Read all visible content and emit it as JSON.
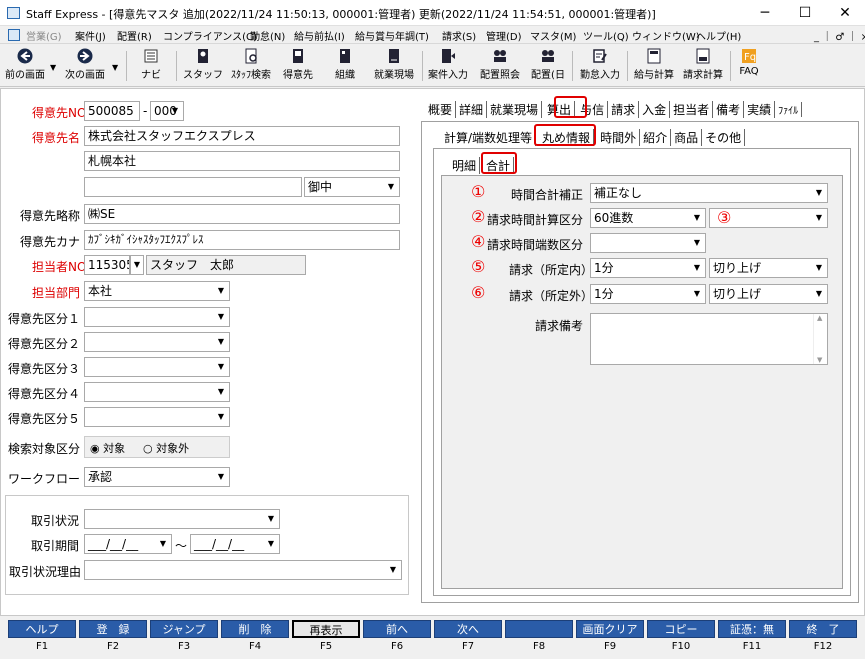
{
  "window": {
    "title": "Staff Express - [得意先マスタ 追加(2022/11/24 11:50:13, 000001:管理者) 更新(2022/11/24 11:54:51, 000001:管理者)]",
    "minimize": "─",
    "maximize": "☐",
    "close": "✕"
  },
  "menu": {
    "items": [
      "営業(G)",
      "案件(J)",
      "配置(R)",
      "コンプライアンス(C)",
      "勤怠(N)",
      "給与前払(I)",
      "給与賞与年調(T)",
      "請求(S)",
      "管理(D)",
      "マスタ(M)",
      "ツール(Q)",
      "ウィンドウ(W)",
      "ヘルプ(H)"
    ],
    "right": "_ ｜ ♂ ｜ ×"
  },
  "toolbar": {
    "items": [
      "前の画面",
      "次の画面",
      "ナビ",
      "スタッフ",
      "ｽﾀｯﾌ検索",
      "得意先",
      "組織",
      "就業現場",
      "案件入力",
      "配置照会",
      "配置(日",
      "勤怠入力",
      "給与計算",
      "請求計算",
      "FAQ"
    ]
  },
  "left": {
    "code_label": "得意先NO",
    "code_value": "500085",
    "code_sep": "-",
    "branch_value": "000",
    "name_label": "得意先名",
    "name_value": "株式会社スタッフエクスプレス",
    "name2_value": "札幌本社",
    "name3_value": "",
    "honorific": "御中",
    "short_label": "得意先略称",
    "short_value": "㈱SE",
    "kana_label": "得意先カナ",
    "kana_value": "ｶﾌﾞｼｷｶﾞｲｼｬｽﾀｯﾌｴｸｽﾌﾟﾚｽ",
    "person_label": "担当者NO",
    "person_no": "115305",
    "person_name": "スタッフ　太郎",
    "dept_label": "担当部門",
    "dept_value": "本社",
    "cat1": "得意先区分１",
    "cat2": "得意先区分２",
    "cat3": "得意先区分３",
    "cat4": "得意先区分４",
    "cat5": "得意先区分５",
    "search_label": "検索対象区分",
    "radio_on": "対象",
    "radio_off": "対象外",
    "workflow_label": "ワークフロー",
    "workflow_value": "承認",
    "status_label": "取引状況",
    "period_label": "取引期間",
    "period_from": "___/__/__",
    "period_tilde": "～",
    "period_to": "___/__/__",
    "reason_label": "取引状況理由"
  },
  "tabs": {
    "top": [
      "概要",
      "詳細",
      "就業現場",
      "算出",
      "与信",
      "請求",
      "入金",
      "担当者",
      "備考",
      "実績",
      "ﾌｧｲﾙ"
    ],
    "sub": [
      "計算/端数処理等",
      "丸め情報",
      "時間外",
      "紹介",
      "商品",
      "その他"
    ],
    "inner": [
      "明細",
      "合計"
    ]
  },
  "form": {
    "n1": "①",
    "time_total_label": "時間合計補正",
    "time_total_value": "補正なし",
    "n2": "②",
    "calc_label": "請求時間計算区分",
    "calc_value": "60進数",
    "n3": "③",
    "calc2_value": "",
    "n4": "④",
    "frac_label": "請求時間端数区分",
    "frac_value": "",
    "n5": "⑤",
    "in_label": "請求（所定内）",
    "in_value": "1分",
    "in_round": "切り上げ",
    "n6": "⑥",
    "out_label": "請求（所定外）",
    "out_value": "1分",
    "out_round": "切り上げ",
    "memo_label": "請求備考"
  },
  "fkeys": [
    {
      "label": "ヘルプ",
      "key": "F1"
    },
    {
      "label": "登　録",
      "key": "F2"
    },
    {
      "label": "ジャンプ",
      "key": "F3"
    },
    {
      "label": "削　除",
      "key": "F4"
    },
    {
      "label": "再表示",
      "key": "F5"
    },
    {
      "label": "前へ",
      "key": "F6"
    },
    {
      "label": "次へ",
      "key": "F7"
    },
    {
      "label": "",
      "key": "F8"
    },
    {
      "label": "画面クリア",
      "key": "F9"
    },
    {
      "label": "コピー",
      "key": "F10"
    },
    {
      "label": "証憑：無",
      "key": "F11"
    },
    {
      "label": "終　了",
      "key": "F12"
    }
  ],
  "colors": {
    "accent": "#2a5ca8",
    "required_label": "#dd0000",
    "highlight": "#e00000"
  }
}
